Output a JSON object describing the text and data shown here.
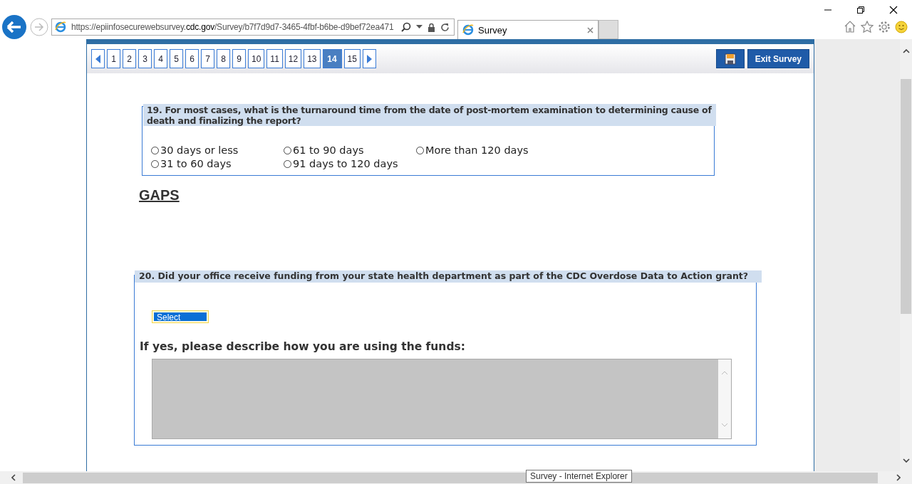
{
  "browser": {
    "address": "https://epiinfosecurewebsurvey.**cdc.gov**/Survey/b7f7d9d7-3465-4fbf-b6be-d9bef72ea471",
    "tabs": [
      {
        "title": "Survey",
        "selected": true
      }
    ],
    "tooltip": "Survey - Internet Explorer"
  },
  "survey": {
    "pages": [
      {
        "label": "1",
        "selected": false
      },
      {
        "label": "2",
        "selected": false
      },
      {
        "label": "3",
        "selected": false
      },
      {
        "label": "4",
        "selected": false
      },
      {
        "label": "5",
        "selected": false
      },
      {
        "label": "6",
        "selected": false
      },
      {
        "label": "7",
        "selected": false
      },
      {
        "label": "8",
        "selected": false
      },
      {
        "label": "9",
        "selected": false
      },
      {
        "label": "10",
        "selected": false
      },
      {
        "label": "11",
        "selected": false
      },
      {
        "label": "12",
        "selected": false
      },
      {
        "label": "13",
        "selected": false
      },
      {
        "label": "14",
        "selected": true
      },
      {
        "label": "15",
        "selected": false
      }
    ],
    "exit_button": "Exit Survey",
    "question_19": {
      "text": "19. For most cases, what is the turnaround time from the date of post-mortem examination to determining cause of death and finalizing the report?",
      "options": [
        {
          "label": "30 days or less",
          "selected": false
        },
        {
          "label": "31 to 60 days",
          "selected": false
        },
        {
          "label": "61 to 90 days",
          "selected": false
        },
        {
          "label": "91 days to 120 days",
          "selected": false
        },
        {
          "label": "More than 120 days",
          "selected": false
        }
      ]
    },
    "section_heading": "GAPS",
    "question_20": {
      "text": "20. Did your office receive funding from your state health department as part of the CDC Overdose Data to Action grant?",
      "dropdown": {
        "value": "Select"
      },
      "follow_up_label": "If yes, please describe how you are using the funds:"
    }
  }
}
